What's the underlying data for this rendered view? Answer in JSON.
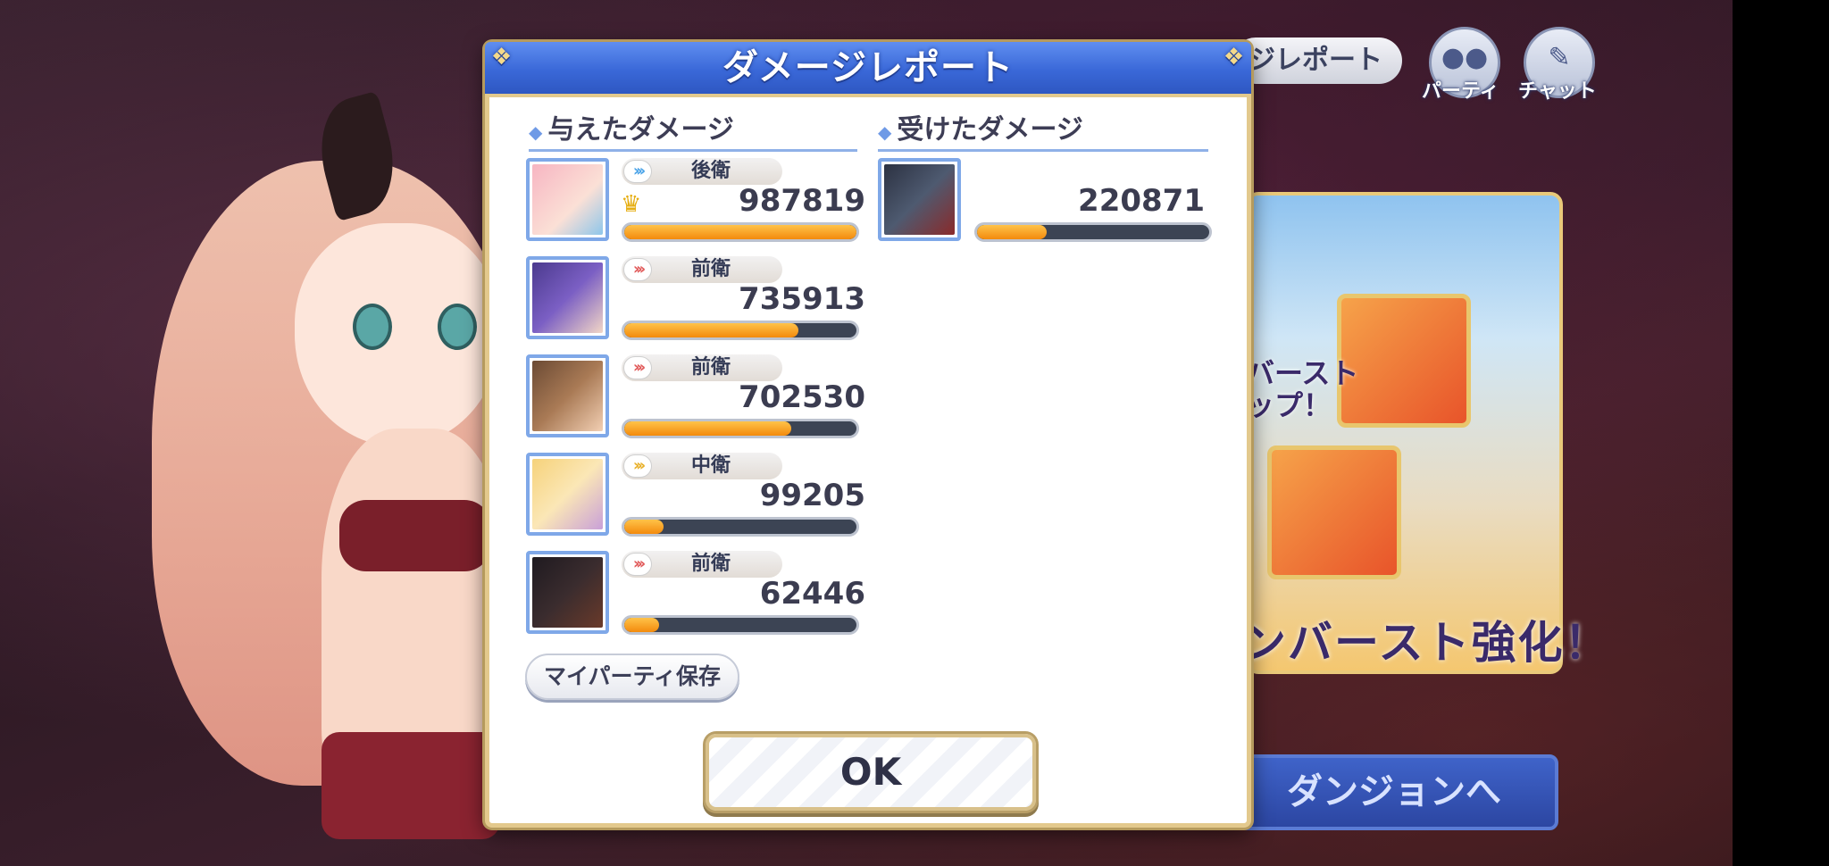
{
  "background": {
    "report_tab_label": "ジレポート",
    "party_icon_label": "パーティ",
    "chat_icon_label": "チャット",
    "promo_side_text": "バースト\nップ！",
    "promo_bottom_text": "ンバースト強化！",
    "dungeon_button_label": "ダンジョンへ"
  },
  "dialog": {
    "title": "ダメージレポート",
    "dealt_section_title": "与えたダメージ",
    "received_section_title": "受けたダメージ",
    "dealt": [
      {
        "position": "後衛",
        "damage": "987819",
        "top": true,
        "bar_fraction": 1.0,
        "chevron_color": "#4aa3e8"
      },
      {
        "position": "前衛",
        "damage": "735913",
        "top": false,
        "bar_fraction": 0.75,
        "chevron_color": "#e15a5a"
      },
      {
        "position": "前衛",
        "damage": "702530",
        "top": false,
        "bar_fraction": 0.72,
        "chevron_color": "#e15a5a"
      },
      {
        "position": "中衛",
        "damage": "99205",
        "top": false,
        "bar_fraction": 0.17,
        "chevron_color": "#e8b02a"
      },
      {
        "position": "前衛",
        "damage": "62446",
        "top": false,
        "bar_fraction": 0.15,
        "chevron_color": "#e15a5a"
      }
    ],
    "received": [
      {
        "damage": "220871",
        "bar_fraction": 0.3
      }
    ],
    "save_party_label": "マイパーティ保存",
    "ok_label": "OK"
  }
}
